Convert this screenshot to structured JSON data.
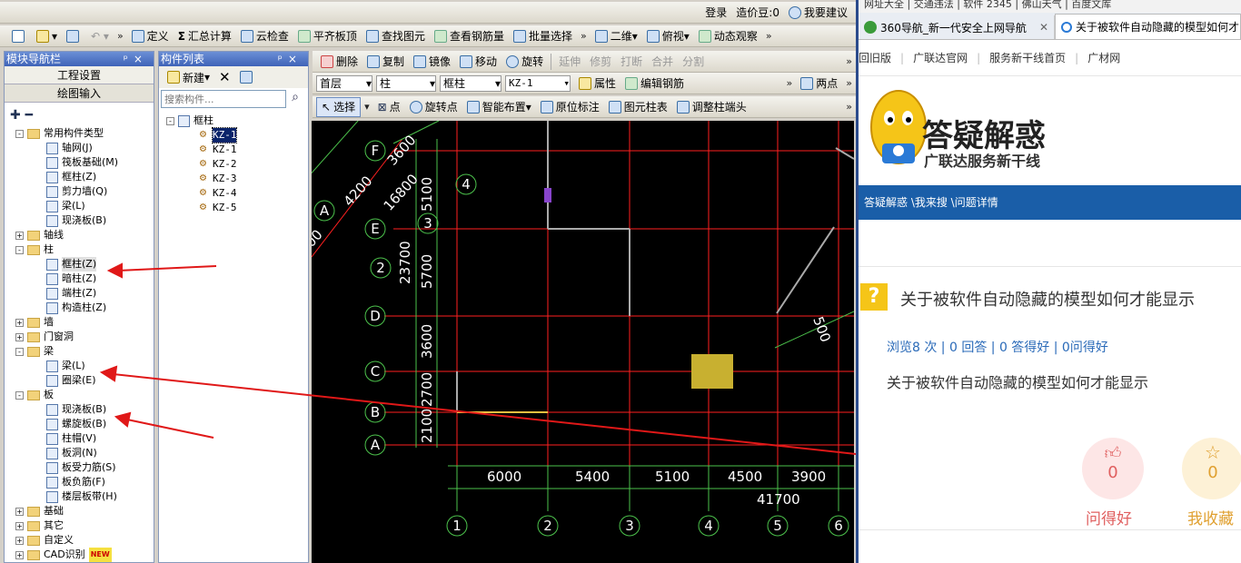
{
  "toolbar1": {
    "login": "登录",
    "cost_label": "造价豆:0",
    "suggest": "我要建议"
  },
  "toolbar2": {
    "define": "定义",
    "sum": "汇总计算",
    "cloud_check": "云检查",
    "flat_top": "平齐板顶",
    "find_elem": "查找图元",
    "view_rebar": "查看钢筋量",
    "batch_select": "批量选择",
    "view_2d": "二维",
    "top_view": "俯视",
    "dynamic_view": "动态观察"
  },
  "toolbar3": {
    "delete": "删除",
    "copy": "复制",
    "mirror": "镜像",
    "move": "移动",
    "rotate": "旋转",
    "extend": "延伸",
    "trim": "修剪",
    "break": "打断",
    "merge": "合并",
    "split": "分割"
  },
  "toolbar4": {
    "floor": "首层",
    "type": "柱",
    "subtype": "框柱",
    "component": "KZ-1",
    "property": "属性",
    "edit_rebar": "编辑钢筋",
    "two_point": "两点"
  },
  "toolbar5": {
    "select": "选择",
    "point": "点",
    "rotate_point": "旋转点",
    "smart_layout": "智能布置",
    "origin_mark": "原位标注",
    "elem_table": "图元柱表",
    "adjust_end": "调整柱端头"
  },
  "nav_panel": {
    "title": "模块导航栏",
    "project_settings": "工程设置",
    "drawing_input": "绘图输入",
    "tree": [
      "常用构件类型",
      "轴网(J)",
      "筏板基础(M)",
      "框柱(Z)",
      "剪力墙(Q)",
      "梁(L)",
      "现浇板(B)",
      "轴线",
      "柱",
      "框柱(Z)",
      "暗柱(Z)",
      "端柱(Z)",
      "构造柱(Z)",
      "墙",
      "门窗洞",
      "梁",
      "梁(L)",
      "圈梁(E)",
      "板",
      "现浇板(B)",
      "螺旋板(B)",
      "柱帽(V)",
      "板洞(N)",
      "板受力筋(S)",
      "板负筋(F)",
      "楼层板带(H)",
      "基础",
      "其它",
      "自定义",
      "CAD识别"
    ],
    "new_badge": "NEW"
  },
  "comp_panel": {
    "title": "构件列表",
    "new": "新建",
    "search_placeholder": "搜索构件...",
    "root": "框柱",
    "items": [
      "KZ-1",
      "KZ-1",
      "KZ-2",
      "KZ-3",
      "KZ-4",
      "KZ-5"
    ]
  },
  "cad": {
    "axis_letters": [
      "F",
      "E",
      "D",
      "C",
      "B",
      "A",
      "A"
    ],
    "axis_numbers": [
      "1",
      "2",
      "3",
      "4",
      "5",
      "6",
      "4",
      "3",
      "2"
    ],
    "dims_bottom": [
      "6000",
      "5400",
      "5100",
      "4500",
      "3900"
    ],
    "total": "41700",
    "dims_left": [
      "5100",
      "5700",
      "3600",
      "2700",
      "2100"
    ],
    "dim_23700": "23700",
    "diag": [
      "3600",
      "16800",
      "4200",
      "00"
    ],
    "dim_500": "500"
  },
  "browser": {
    "tab1": "360导航_新一代安全上网导航",
    "tab2": "关于被软件自动隐藏的模型如何才",
    "bookmarks_top": "网址大全  |  交通违法  |  软件 2345  |  佛山天气  |  百度文库",
    "nav_links": [
      "回旧版",
      "广联达官网",
      "服务新干线首页",
      "广材网"
    ],
    "logo_title": "答疑解惑",
    "logo_sub": "广联达服务新干线",
    "breadcrumb": "答疑解惑 \\我来搜 \\问题详情",
    "question_title": "关于被软件自动隐藏的模型如何才能显示",
    "stats": "浏览8 次 | 0 回答 | 0 答得好 | 0问得好",
    "question_body": "关于被软件自动隐藏的模型如何才能显示",
    "like_count": "0",
    "like_label": "问得好",
    "fav_count": "0",
    "fav_label": "我收藏"
  },
  "colors": {
    "cad_bg": "#000000",
    "axis_red": "#ff2020",
    "axis_green": "#4cc24c",
    "annot_arrow": "#e01818",
    "brand_blue": "#1a5ea8"
  }
}
